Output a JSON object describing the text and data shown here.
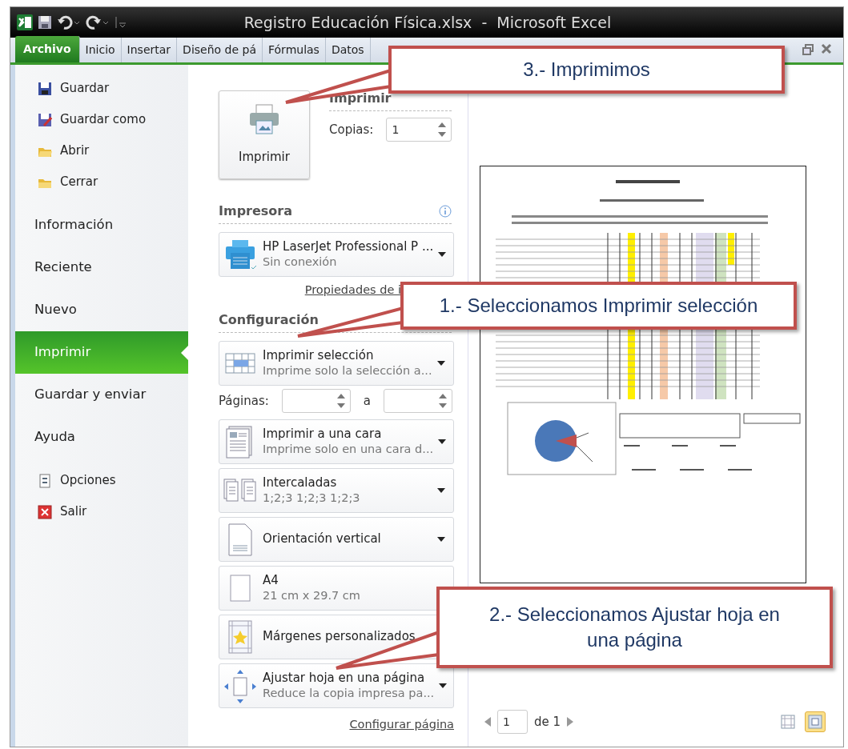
{
  "window": {
    "title": "Registro Educación Física.xlsx  -  Microsoft Excel"
  },
  "tabs": [
    {
      "label": "Archivo",
      "selected": true
    },
    {
      "label": "Inicio",
      "selected": false
    },
    {
      "label": "Insertar",
      "selected": false
    },
    {
      "label": "Diseño de pá",
      "selected": false
    },
    {
      "label": "Fórmulas",
      "selected": false
    },
    {
      "label": "Datos",
      "selected": false
    }
  ],
  "sidebar": {
    "items": [
      {
        "kind": "small",
        "label": "Guardar",
        "selected": false
      },
      {
        "kind": "small",
        "label": "Guardar como",
        "selected": false
      },
      {
        "kind": "small",
        "label": "Abrir",
        "selected": false
      },
      {
        "kind": "small",
        "label": "Cerrar",
        "selected": false
      },
      {
        "kind": "large",
        "label": "Información",
        "selected": false
      },
      {
        "kind": "large",
        "label": "Reciente",
        "selected": false
      },
      {
        "kind": "large",
        "label": "Nuevo",
        "selected": false
      },
      {
        "kind": "large",
        "label": "Imprimir",
        "selected": true
      },
      {
        "kind": "large",
        "label": "Guardar y enviar",
        "selected": false
      },
      {
        "kind": "large",
        "label": "Ayuda",
        "selected": false
      },
      {
        "kind": "small",
        "label": "Opciones",
        "selected": false
      },
      {
        "kind": "small",
        "label": "Salir",
        "selected": false
      }
    ]
  },
  "print": {
    "button": "Imprimir",
    "heading": "Imprimir",
    "copies_label": "Copias:",
    "copies": "1"
  },
  "printer": {
    "heading": "Impresora",
    "name": "HP LaserJet Professional P ...",
    "status": "Sin conexión",
    "link": "Propiedades de i"
  },
  "settings": {
    "heading": "Configuración",
    "items": [
      {
        "kind": "dropdown",
        "title": "Imprimir selección",
        "subtitle": "Imprime solo la selección a...",
        "caret": true
      },
      {
        "kind": "pages",
        "label": "Páginas:",
        "to_label": "a"
      },
      {
        "kind": "dropdown",
        "title": "Imprimir a una cara",
        "subtitle": "Imprime solo en una cara d...",
        "caret": true
      },
      {
        "kind": "dropdown",
        "title": "Intercaladas",
        "subtitle": "1;2;3    1;2;3    1;2;3",
        "caret": true
      },
      {
        "kind": "dropdown",
        "title": "Orientación vertical",
        "caret": true
      },
      {
        "kind": "dropdown",
        "title": "A4",
        "subtitle": "21 cm x 29.7 cm",
        "caret": false
      },
      {
        "kind": "dropdown",
        "title": "Márgenes personalizados",
        "caret": false
      },
      {
        "kind": "dropdown",
        "title": "Ajustar hoja en una página",
        "subtitle": "Reduce la copia impresa pa...",
        "caret": true
      }
    ],
    "link": "Configurar página"
  },
  "preview": {
    "page": "1",
    "of": "de 1",
    "views": [
      {
        "selected": false
      },
      {
        "selected": true
      }
    ]
  },
  "callouts": [
    {
      "text": "3.- Imprimimos"
    },
    {
      "text": "1.- Seleccionamos Imprimir selección"
    },
    {
      "text": "2.- Seleccionamos Ajustar hoja en una página"
    }
  ]
}
